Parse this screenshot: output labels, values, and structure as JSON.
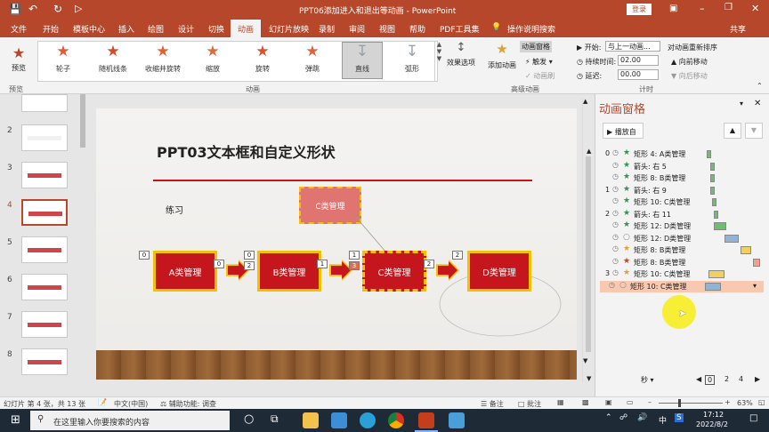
{
  "window": {
    "title": "PPT06添加进入和退出等动画 - PowerPoint",
    "login": "登录"
  },
  "tabs": [
    "文件",
    "开始",
    "模板中心",
    "插入",
    "绘图",
    "设计",
    "切换",
    "动画",
    "幻灯片放映",
    "录制",
    "审阅",
    "视图",
    "帮助",
    "PDF工具集",
    "操作说明搜索"
  ],
  "share": "共享",
  "ribbon": {
    "preview": "预览",
    "preview_group": "预览",
    "animations": [
      {
        "label": "轮子",
        "color": "#e05a38"
      },
      {
        "label": "随机线条",
        "color": "#d64a2a"
      },
      {
        "label": "收缩并旋转",
        "color": "#e06030"
      },
      {
        "label": "缩放",
        "color": "#e06a3c"
      },
      {
        "label": "旋转",
        "color": "#dc5030"
      },
      {
        "label": "弹跳",
        "color": "#e0603a"
      },
      {
        "label": "直线",
        "color": "#9aa0a6"
      },
      {
        "label": "弧形",
        "color": "#9aa0a6"
      }
    ],
    "effect_options": "效果选项",
    "anim_group": "动画",
    "add_animation": "添加动画",
    "anim_pane": "动画窗格",
    "trigger": "触发",
    "anim_painter": "动画刷",
    "advanced_group": "高级动画",
    "start_label": "开始:",
    "start_value": "与上一动画...",
    "duration_label": "持续时间:",
    "duration_value": "02.00",
    "delay_label": "延迟:",
    "delay_value": "00.00",
    "timing_group": "计时",
    "reorder": "对动画重新排序",
    "move_earlier": "向前移动",
    "move_later": "向后移动"
  },
  "slides": [
    {
      "num": "2"
    },
    {
      "num": "3"
    },
    {
      "num": "4"
    },
    {
      "num": "5"
    },
    {
      "num": "6"
    },
    {
      "num": "7"
    },
    {
      "num": "8"
    }
  ],
  "slide": {
    "title": "PPT03文本框和自定义形状",
    "practice": "练习",
    "top_box": "C类管理",
    "boxes": [
      "A类管理",
      "B类管理",
      "C类管理",
      "D类管理"
    ],
    "tags": [
      "0",
      "0",
      "0",
      "2",
      "1",
      "3",
      "2",
      "2"
    ]
  },
  "pane": {
    "title": "动画窗格",
    "play": "播放自",
    "items": [
      {
        "num": "0",
        "text": "矩形 4: A类管理",
        "color": "#3a8f4f",
        "bar": "#6cbf6c"
      },
      {
        "num": "",
        "text": "箭头: 右 5",
        "color": "#3a8f4f",
        "bar": "#6cbf6c"
      },
      {
        "num": "",
        "text": "矩形 8: B类管理",
        "color": "#3a8f4f",
        "bar": "#6cbf6c"
      },
      {
        "num": "1",
        "text": "箭头: 右 9",
        "color": "#3a8f4f",
        "bar": "#6cbf6c"
      },
      {
        "num": "",
        "text": "矩形 10: C类管理",
        "color": "#3a8f4f",
        "bar": "#6cbf6c"
      },
      {
        "num": "2",
        "text": "箭头: 右 11",
        "color": "#3a8f4f",
        "bar": "#6cbf6c"
      },
      {
        "num": "",
        "text": "矩形 12: D类管理",
        "color": "#3a8f4f",
        "bar": "#6cbf6c"
      },
      {
        "num": "",
        "text": "矩形 12: D类管理",
        "color": "#888888",
        "bar": "#8fb4d6"
      },
      {
        "num": "",
        "text": "矩形 8: B类管理",
        "color": "#e0a030",
        "bar": "#f2d060"
      },
      {
        "num": "",
        "text": "矩形 8: B类管理",
        "color": "#c8402a",
        "bar": "#f0a090"
      },
      {
        "num": "3",
        "text": "矩形 10: C类管理",
        "color": "#e0a030",
        "bar": "#f2d060"
      },
      {
        "num": "",
        "text": "矩形 10: C类管理",
        "color": "#888888",
        "bar": "#8fb4d6"
      }
    ],
    "seconds": "秒",
    "scale": [
      "0",
      "2",
      "4"
    ]
  },
  "status": {
    "slide": "幻灯片 第 4 张，共 13 张",
    "lang": "中文(中国)",
    "access": "辅助功能: 调查",
    "notes": "备注",
    "comments": "批注",
    "zoom": "63%"
  },
  "taskbar": {
    "search": "在这里输入你要搜索的内容",
    "time": "17:12",
    "date": "2022/8/2",
    "ime": "中"
  }
}
